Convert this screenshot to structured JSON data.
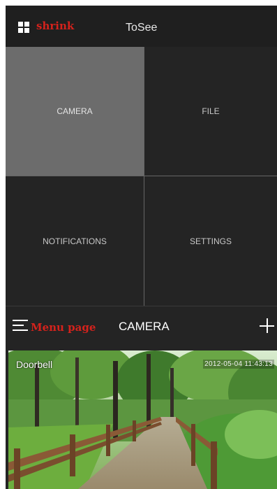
{
  "topbar": {
    "grid_icon": "grid-icon",
    "shrink_label": "shrink",
    "app_title": "ToSee"
  },
  "tiles": [
    {
      "label": "CAMERA",
      "active": true
    },
    {
      "label": "FILE",
      "active": false
    },
    {
      "label": "NOTIFICATIONS",
      "active": false
    },
    {
      "label": "SETTINGS",
      "active": false
    }
  ],
  "menubar": {
    "menu_icon": "hamburger-icon",
    "menu_label": "Menu page",
    "title": "CAMERA",
    "add_icon": "plus-icon"
  },
  "camera_preview": {
    "name": "Doorbell",
    "timestamp": "2012-05-04 11:43:13"
  },
  "colors": {
    "background": "#242424",
    "active_tile": "#6c6c6c",
    "annotation_red": "#d4221c",
    "text_light": "#c8c8c8"
  }
}
